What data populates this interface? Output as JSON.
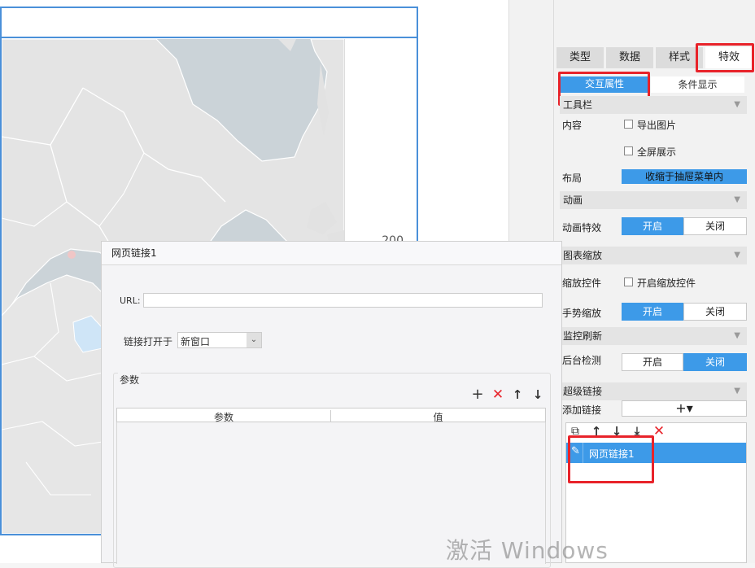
{
  "map": {
    "legend_value": "200"
  },
  "tabs": [
    {
      "label": "类型"
    },
    {
      "label": "数据"
    },
    {
      "label": "样式"
    },
    {
      "label": "特效"
    }
  ],
  "subtabs": {
    "interactive": "交互属性",
    "conditional": "条件显示"
  },
  "sections": {
    "toolbar": {
      "title": "工具栏",
      "content_label": "内容",
      "export_image": "导出图片",
      "fullscreen": "全屏展示",
      "layout_label": "布局",
      "layout_value": "收缩于抽屉菜单内"
    },
    "animation": {
      "title": "动画",
      "effect_label": "动画特效",
      "on": "开启",
      "off": "关闭",
      "state": "开启"
    },
    "zoom": {
      "title": "图表缩放",
      "zoom_control_label": "缩放控件",
      "zoom_control_checkbox": "开启缩放控件",
      "gesture_label": "手势缩放",
      "on": "开启",
      "off": "关闭",
      "state": "开启"
    },
    "refresh": {
      "title": "监控刷新",
      "backend_label": "后台检测",
      "on": "开启",
      "off": "关闭",
      "state": "关闭"
    },
    "hyperlink": {
      "title": "超级链接",
      "add_label": "添加链接",
      "add_button": "+▾",
      "items": [
        {
          "label": "网页链接1"
        }
      ]
    }
  },
  "dialog": {
    "title": "网页链接1",
    "url_label": "URL:",
    "url_value": "",
    "open_in_label": "链接打开于",
    "open_in_value": "新窗口",
    "params_legend": "参数",
    "params_columns": [
      "参数",
      "值"
    ]
  },
  "watermark": "激活 Windows",
  "colors": {
    "accent": "#3d9ae8",
    "highlight": "#e8232a",
    "map_border": "#4a90d9"
  }
}
